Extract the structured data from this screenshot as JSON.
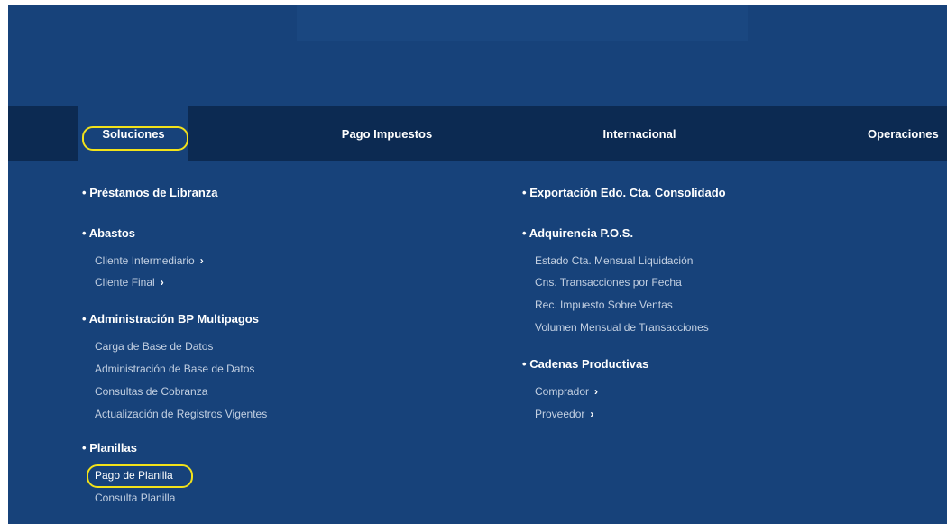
{
  "nav": {
    "tabs": [
      {
        "label": "Soluciones"
      },
      {
        "label": "Pago Impuestos"
      },
      {
        "label": "Internacional"
      },
      {
        "label": "Operaciones"
      }
    ]
  },
  "menu": {
    "bullet": "•",
    "chevron": "›",
    "left": {
      "prestamos": "Préstamos de Libranza",
      "abastos": "Abastos",
      "abastos_items": [
        "Cliente Intermediario",
        "Cliente Final"
      ],
      "bp": "Administración BP Multipagos",
      "bp_items": [
        "Carga de Base de Datos",
        "Administración de Base de Datos",
        "Consultas de Cobranza",
        "Actualización de Registros Vigentes"
      ],
      "planillas": "Planillas",
      "planillas_items": [
        "Pago de Planilla",
        "Consulta Planilla"
      ]
    },
    "right": {
      "exportacion": "Exportación Edo. Cta. Consolidado",
      "adquirencia": "Adquirencia P.O.S.",
      "adquirencia_items": [
        "Estado Cta. Mensual Liquidación",
        "Cns. Transacciones por Fecha",
        "Rec. Impuesto Sobre Ventas",
        "Volumen Mensual de Transacciones"
      ],
      "cadenas": "Cadenas Productivas",
      "cadenas_items": [
        "Comprador",
        "Proveedor"
      ]
    }
  },
  "colors": {
    "background": "#17427a",
    "navbar": "#0c2a52",
    "highlight": "#f2e21a",
    "sub_item_text": "#c3d0e2"
  }
}
